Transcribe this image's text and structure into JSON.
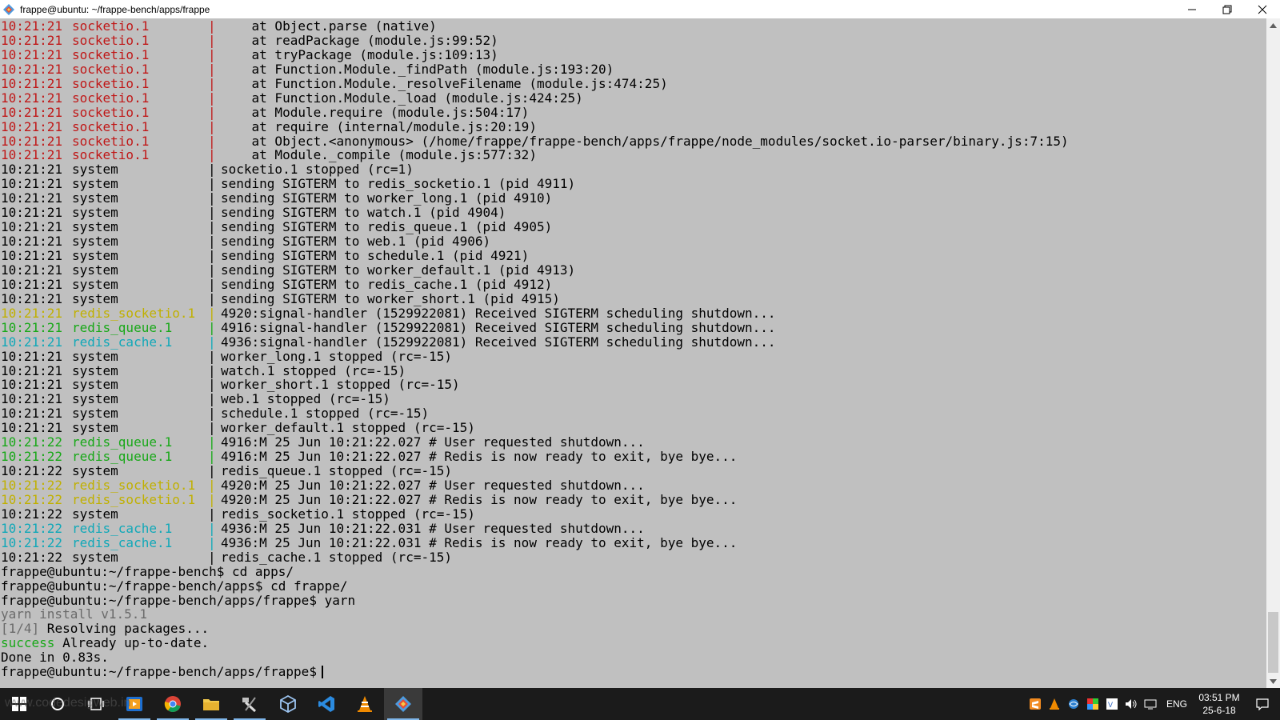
{
  "window": {
    "title": "frappe@ubuntu: ~/frappe-bench/apps/frappe",
    "controls": {
      "minimize": "─",
      "maximize": "❐",
      "close": "✕"
    }
  },
  "colors": {
    "terminal_bg": "#c0c0c0",
    "text": "#000000",
    "socketio": "#c01818",
    "redis_socketio": "#c0b000",
    "redis_queue": "#18a818",
    "redis_cache": "#10a8b8",
    "yarn_gray": "#6a6a6a",
    "success_green": "#18a818",
    "taskbar_bg": "#1b1b1b"
  },
  "terminal": {
    "log_lines": [
      {
        "ts": "10:21:21",
        "proc": "socketio.1",
        "color": "socketio",
        "msg": "    at Object.parse (native)"
      },
      {
        "ts": "10:21:21",
        "proc": "socketio.1",
        "color": "socketio",
        "msg": "    at readPackage (module.js:99:52)"
      },
      {
        "ts": "10:21:21",
        "proc": "socketio.1",
        "color": "socketio",
        "msg": "    at tryPackage (module.js:109:13)"
      },
      {
        "ts": "10:21:21",
        "proc": "socketio.1",
        "color": "socketio",
        "msg": "    at Function.Module._findPath (module.js:193:20)"
      },
      {
        "ts": "10:21:21",
        "proc": "socketio.1",
        "color": "socketio",
        "msg": "    at Function.Module._resolveFilename (module.js:474:25)"
      },
      {
        "ts": "10:21:21",
        "proc": "socketio.1",
        "color": "socketio",
        "msg": "    at Function.Module._load (module.js:424:25)"
      },
      {
        "ts": "10:21:21",
        "proc": "socketio.1",
        "color": "socketio",
        "msg": "    at Module.require (module.js:504:17)"
      },
      {
        "ts": "10:21:21",
        "proc": "socketio.1",
        "color": "socketio",
        "msg": "    at require (internal/module.js:20:19)"
      },
      {
        "ts": "10:21:21",
        "proc": "socketio.1",
        "color": "socketio",
        "msg": "    at Object.<anonymous> (/home/frappe/frappe-bench/apps/frappe/node_modules/socket.io-parser/binary.js:7:15)"
      },
      {
        "ts": "10:21:21",
        "proc": "socketio.1",
        "color": "socketio",
        "msg": "    at Module._compile (module.js:577:32)"
      },
      {
        "ts": "10:21:21",
        "proc": "system",
        "color": "text",
        "msg": "socketio.1 stopped (rc=1)"
      },
      {
        "ts": "10:21:21",
        "proc": "system",
        "color": "text",
        "msg": "sending SIGTERM to redis_socketio.1 (pid 4911)"
      },
      {
        "ts": "10:21:21",
        "proc": "system",
        "color": "text",
        "msg": "sending SIGTERM to worker_long.1 (pid 4910)"
      },
      {
        "ts": "10:21:21",
        "proc": "system",
        "color": "text",
        "msg": "sending SIGTERM to watch.1 (pid 4904)"
      },
      {
        "ts": "10:21:21",
        "proc": "system",
        "color": "text",
        "msg": "sending SIGTERM to redis_queue.1 (pid 4905)"
      },
      {
        "ts": "10:21:21",
        "proc": "system",
        "color": "text",
        "msg": "sending SIGTERM to web.1 (pid 4906)"
      },
      {
        "ts": "10:21:21",
        "proc": "system",
        "color": "text",
        "msg": "sending SIGTERM to schedule.1 (pid 4921)"
      },
      {
        "ts": "10:21:21",
        "proc": "system",
        "color": "text",
        "msg": "sending SIGTERM to worker_default.1 (pid 4913)"
      },
      {
        "ts": "10:21:21",
        "proc": "system",
        "color": "text",
        "msg": "sending SIGTERM to redis_cache.1 (pid 4912)"
      },
      {
        "ts": "10:21:21",
        "proc": "system",
        "color": "text",
        "msg": "sending SIGTERM to worker_short.1 (pid 4915)"
      },
      {
        "ts": "10:21:21",
        "proc": "redis_socketio.1",
        "color": "redis_socketio",
        "msg": "4920:signal-handler (1529922081) Received SIGTERM scheduling shutdown..."
      },
      {
        "ts": "10:21:21",
        "proc": "redis_queue.1",
        "color": "redis_queue",
        "msg": "4916:signal-handler (1529922081) Received SIGTERM scheduling shutdown..."
      },
      {
        "ts": "10:21:21",
        "proc": "redis_cache.1",
        "color": "redis_cache",
        "msg": "4936:signal-handler (1529922081) Received SIGTERM scheduling shutdown..."
      },
      {
        "ts": "10:21:21",
        "proc": "system",
        "color": "text",
        "msg": "worker_long.1 stopped (rc=-15)"
      },
      {
        "ts": "10:21:21",
        "proc": "system",
        "color": "text",
        "msg": "watch.1 stopped (rc=-15)"
      },
      {
        "ts": "10:21:21",
        "proc": "system",
        "color": "text",
        "msg": "worker_short.1 stopped (rc=-15)"
      },
      {
        "ts": "10:21:21",
        "proc": "system",
        "color": "text",
        "msg": "web.1 stopped (rc=-15)"
      },
      {
        "ts": "10:21:21",
        "proc": "system",
        "color": "text",
        "msg": "schedule.1 stopped (rc=-15)"
      },
      {
        "ts": "10:21:21",
        "proc": "system",
        "color": "text",
        "msg": "worker_default.1 stopped (rc=-15)"
      },
      {
        "ts": "10:21:22",
        "proc": "redis_queue.1",
        "color": "redis_queue",
        "msg": "4916:M 25 Jun 10:21:22.027 # User requested shutdown..."
      },
      {
        "ts": "10:21:22",
        "proc": "redis_queue.1",
        "color": "redis_queue",
        "msg": "4916:M 25 Jun 10:21:22.027 # Redis is now ready to exit, bye bye..."
      },
      {
        "ts": "10:21:22",
        "proc": "system",
        "color": "text",
        "msg": "redis_queue.1 stopped (rc=-15)"
      },
      {
        "ts": "10:21:22",
        "proc": "redis_socketio.1",
        "color": "redis_socketio",
        "msg": "4920:M 25 Jun 10:21:22.027 # User requested shutdown..."
      },
      {
        "ts": "10:21:22",
        "proc": "redis_socketio.1",
        "color": "redis_socketio",
        "msg": "4920:M 25 Jun 10:21:22.027 # Redis is now ready to exit, bye bye..."
      },
      {
        "ts": "10:21:22",
        "proc": "system",
        "color": "text",
        "msg": "redis_socketio.1 stopped (rc=-15)"
      },
      {
        "ts": "10:21:22",
        "proc": "redis_cache.1",
        "color": "redis_cache",
        "msg": "4936:M 25 Jun 10:21:22.031 # User requested shutdown..."
      },
      {
        "ts": "10:21:22",
        "proc": "redis_cache.1",
        "color": "redis_cache",
        "msg": "4936:M 25 Jun 10:21:22.031 # Redis is now ready to exit, bye bye..."
      },
      {
        "ts": "10:21:22",
        "proc": "system",
        "color": "text",
        "msg": "redis_cache.1 stopped (rc=-15)"
      }
    ],
    "shell_lines": [
      {
        "text": "frappe@ubuntu:~/frappe-bench$ cd apps/",
        "color": "text"
      },
      {
        "text": "frappe@ubuntu:~/frappe-bench/apps$ cd frappe/",
        "color": "text"
      },
      {
        "text": "frappe@ubuntu:~/frappe-bench/apps/frappe$ yarn",
        "color": "text"
      },
      {
        "text": "yarn install v1.5.1",
        "color": "yarn_gray"
      },
      {
        "prefix": "[1/4]",
        "prefix_color": "yarn_gray",
        "text": " Resolving packages...",
        "color": "text"
      },
      {
        "prefix": "success",
        "prefix_color": "success_green",
        "text": " Already up-to-date.",
        "color": "text"
      },
      {
        "text": "Done in 0.83s.",
        "color": "text"
      }
    ],
    "prompt": "frappe@ubuntu:~/frappe-bench/apps/frappe$",
    "separator": "|"
  },
  "scrollbar": {
    "up": "▲",
    "down": "▼"
  },
  "taskbar": {
    "icons": [
      {
        "name": "start-windows-icon",
        "running": false
      },
      {
        "name": "cortana-search-icon",
        "running": false
      },
      {
        "name": "task-view-icon",
        "running": false
      },
      {
        "name": "media-player-icon",
        "running": true
      },
      {
        "name": "chrome-icon",
        "running": true
      },
      {
        "name": "file-explorer-icon",
        "running": true
      },
      {
        "name": "tools-icon",
        "running": true
      },
      {
        "name": "virtualbox-icon",
        "running": false
      },
      {
        "name": "vscode-icon",
        "running": false
      },
      {
        "name": "vlc-icon",
        "running": false
      },
      {
        "name": "git-bash-icon",
        "running": true,
        "active": true
      }
    ],
    "tray_icons": [
      "sublime-tray-icon",
      "vlc-tray-icon",
      "network-monitor-tray-icon",
      "colorful-tray-icon",
      "vpn-tray-icon",
      "volume-tray-icon",
      "network-tray-icon"
    ],
    "language": "ENG",
    "time": "03:51 PM",
    "date": "25-6-18"
  },
  "watermark": "www.codedesigweb.in"
}
